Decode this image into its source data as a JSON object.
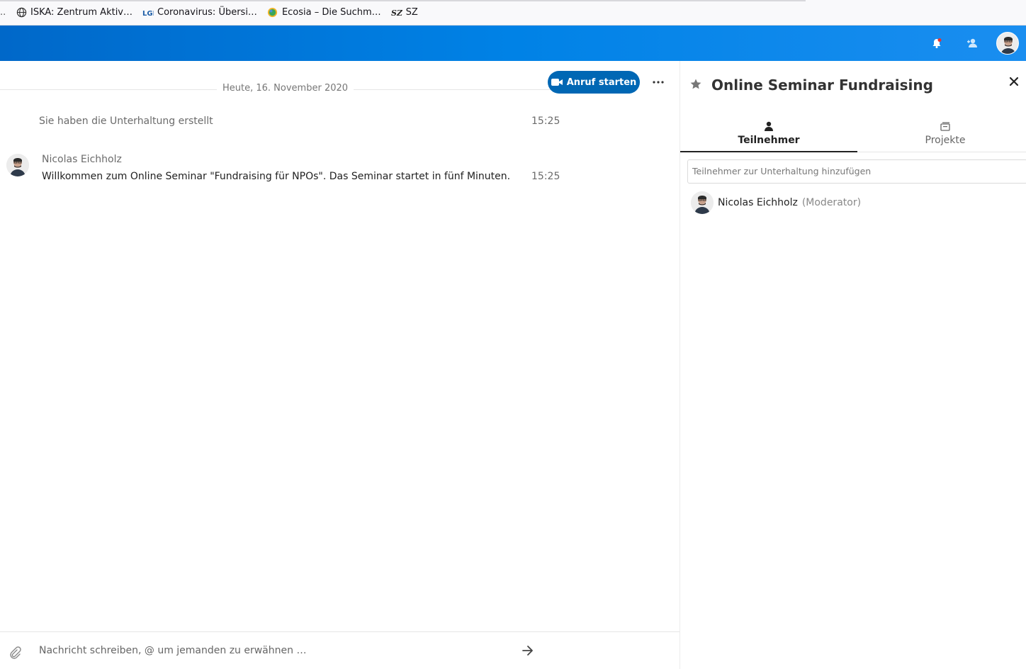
{
  "browser": {
    "bookmarks": [
      {
        "icon": "globe-icon",
        "label": "ISKA: Zentrum Aktiv…"
      },
      {
        "icon": "lgl-logo-icon",
        "label": "Coronavirus: Übersi…"
      },
      {
        "icon": "ecosia-logo-icon",
        "label": "Ecosia – Die Suchm…"
      },
      {
        "icon": "sz-logo-icon",
        "label": "SZ"
      }
    ],
    "leading": ".."
  },
  "header": {
    "icons": [
      "notifications-icon",
      "contacts-icon",
      "user-avatar"
    ],
    "colors": {
      "start": "#0068c9",
      "end": "#1a8ef0",
      "notification_dot": "#e9322d"
    }
  },
  "chat": {
    "date_separator": "Heute, 16. November 2020",
    "call_button": "Anruf starten",
    "system_message": {
      "text": "Sie haben die Unterhaltung erstellt",
      "time": "15:25"
    },
    "message": {
      "author": "Nicolas Eichholz",
      "text": "Willkommen zum Online Seminar \"Fundraising für NPOs\". Das Seminar startet in fünf Minuten.",
      "time": "15:25"
    },
    "composer_placeholder": "Nachricht schreiben, @ um jemanden zu erwähnen …"
  },
  "sidebar": {
    "title": "Online Seminar Fundraising",
    "tabs": [
      {
        "label": "Teilnehmer",
        "icon": "participants-icon",
        "active": true
      },
      {
        "label": "Projekte",
        "icon": "projects-icon",
        "active": false
      }
    ],
    "add_participant_placeholder": "Teilnehmer zur Unterhaltung hinzufügen",
    "participants": [
      {
        "name": "Nicolas Eichholz",
        "role": "(Moderator)"
      }
    ]
  },
  "colors": {
    "call_button": "#0067b4",
    "accent": "#0082c9"
  }
}
